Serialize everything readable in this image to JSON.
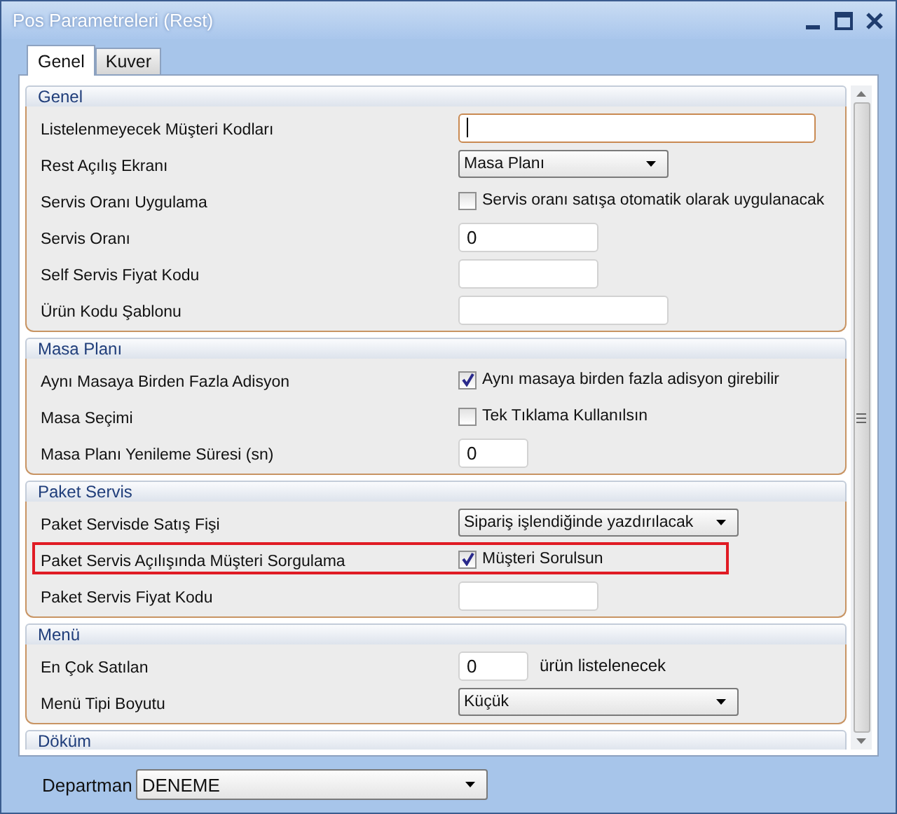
{
  "window": {
    "title": "Pos Parametreleri (Rest)"
  },
  "tabs": [
    {
      "label": "Genel",
      "selected": true
    },
    {
      "label": "Kuver",
      "selected": false
    }
  ],
  "sections": [
    {
      "title": "Genel",
      "rows": [
        {
          "label": "Listelenmeyecek Müşteri Kodları",
          "kind": "input",
          "value": "",
          "focused": true
        },
        {
          "label": "Rest Açılış Ekranı",
          "kind": "dropdown",
          "value": "Masa Planı"
        },
        {
          "label": "Servis Oranı Uygulama",
          "kind": "checkbox",
          "checked": false,
          "text": "Servis oranı satışa otomatik olarak uygulanacak"
        },
        {
          "label": "Servis Oranı",
          "kind": "input",
          "value": "0",
          "focused": false
        },
        {
          "label": "Self Servis Fiyat Kodu",
          "kind": "input",
          "value": "",
          "focused": false
        },
        {
          "label": "Ürün Kodu Şablonu",
          "kind": "input",
          "value": "",
          "focused": false
        }
      ]
    },
    {
      "title": "Masa Planı",
      "rows": [
        {
          "label": "Aynı Masaya Birden Fazla Adisyon",
          "kind": "checkbox",
          "checked": true,
          "text": "Aynı masaya birden fazla adisyon girebilir"
        },
        {
          "label": "Masa Seçimi",
          "kind": "checkbox",
          "checked": false,
          "text": "Tek Tıklama Kullanılsın"
        },
        {
          "label": "Masa Planı Yenileme Süresi (sn)",
          "kind": "input",
          "value": "0",
          "focused": false
        }
      ]
    },
    {
      "title": "Paket Servis",
      "rows": [
        {
          "label": "Paket Servisde Satış Fişi",
          "kind": "dropdown",
          "value": "Sipariş işlendiğinde yazdırılacak"
        },
        {
          "label": "Paket Servis Açılışında Müşteri Sorgulama",
          "kind": "checkbox",
          "checked": true,
          "text": "Müşteri Sorulsun",
          "highlighted": true
        },
        {
          "label": "Paket Servis Fiyat Kodu",
          "kind": "input",
          "value": "",
          "focused": false
        }
      ]
    },
    {
      "title": "Menü",
      "rows": [
        {
          "label": "En Çok Satılan",
          "kind": "input",
          "value": "0",
          "focused": false,
          "suffix": "ürün listelenecek"
        },
        {
          "label": "Menü Tipi Boyutu",
          "kind": "dropdown",
          "value": "Küçük"
        }
      ]
    },
    {
      "title": "Döküm"
    }
  ],
  "department": {
    "label": "Departman",
    "value": "DENEME"
  }
}
